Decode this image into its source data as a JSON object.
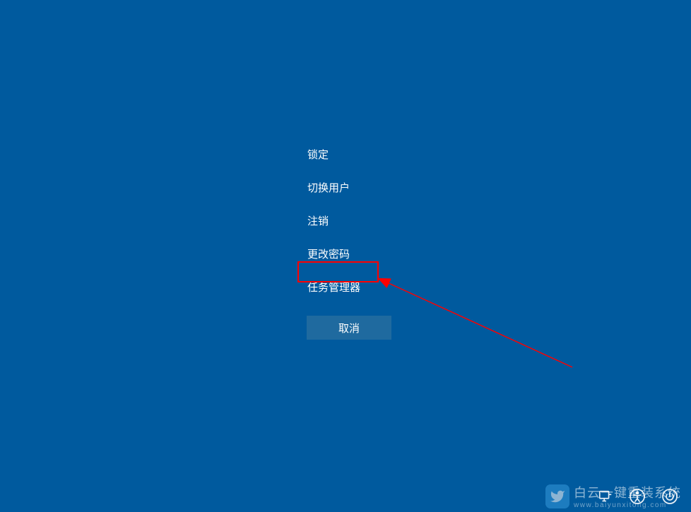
{
  "menu": {
    "lock": "锁定",
    "switch_user": "切换用户",
    "sign_out": "注销",
    "change_password": "更改密码",
    "task_manager": "任务管理器"
  },
  "cancel_button": "取消",
  "watermark": {
    "title": "白云一键重装系统",
    "url": "www.baiyunxitong.com"
  }
}
